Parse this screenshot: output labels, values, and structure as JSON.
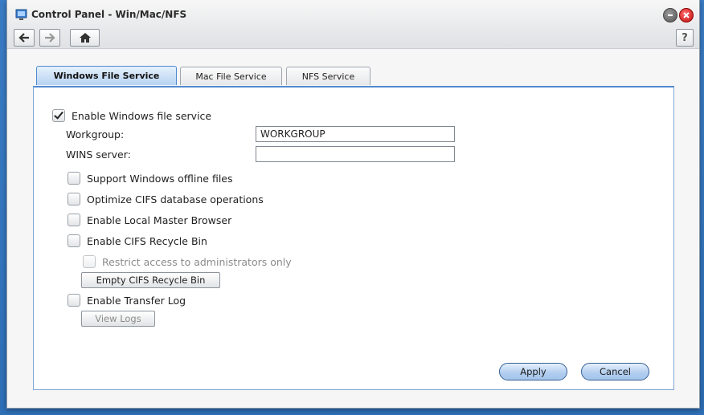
{
  "window": {
    "title": "Control Panel - Win/Mac/NFS",
    "help_label": "?"
  },
  "tabs": [
    {
      "label": "Windows File Service",
      "active": true
    },
    {
      "label": "Mac File Service",
      "active": false
    },
    {
      "label": "NFS Service",
      "active": false
    }
  ],
  "windows_service": {
    "enable_label": "Enable Windows file service",
    "enable_checked": true,
    "workgroup_label": "Workgroup:",
    "workgroup_value": "WORKGROUP",
    "wins_label": "WINS server:",
    "wins_value": "",
    "options": [
      {
        "label": "Support Windows offline files",
        "checked": false
      },
      {
        "label": "Optimize CIFS database operations",
        "checked": false
      },
      {
        "label": "Enable Local Master Browser",
        "checked": false
      },
      {
        "label": "Enable CIFS Recycle Bin",
        "checked": false
      }
    ],
    "restrict_label": "Restrict access to administrators only",
    "empty_bin_label": "Empty CIFS Recycle Bin",
    "transfer_log_label": "Enable Transfer Log",
    "view_logs_label": "View Logs"
  },
  "actions": {
    "apply_label": "Apply",
    "cancel_label": "Cancel"
  },
  "colors": {
    "accent": "#4f8ad0",
    "desktop": "#2e6fb6",
    "close": "#c31010"
  }
}
